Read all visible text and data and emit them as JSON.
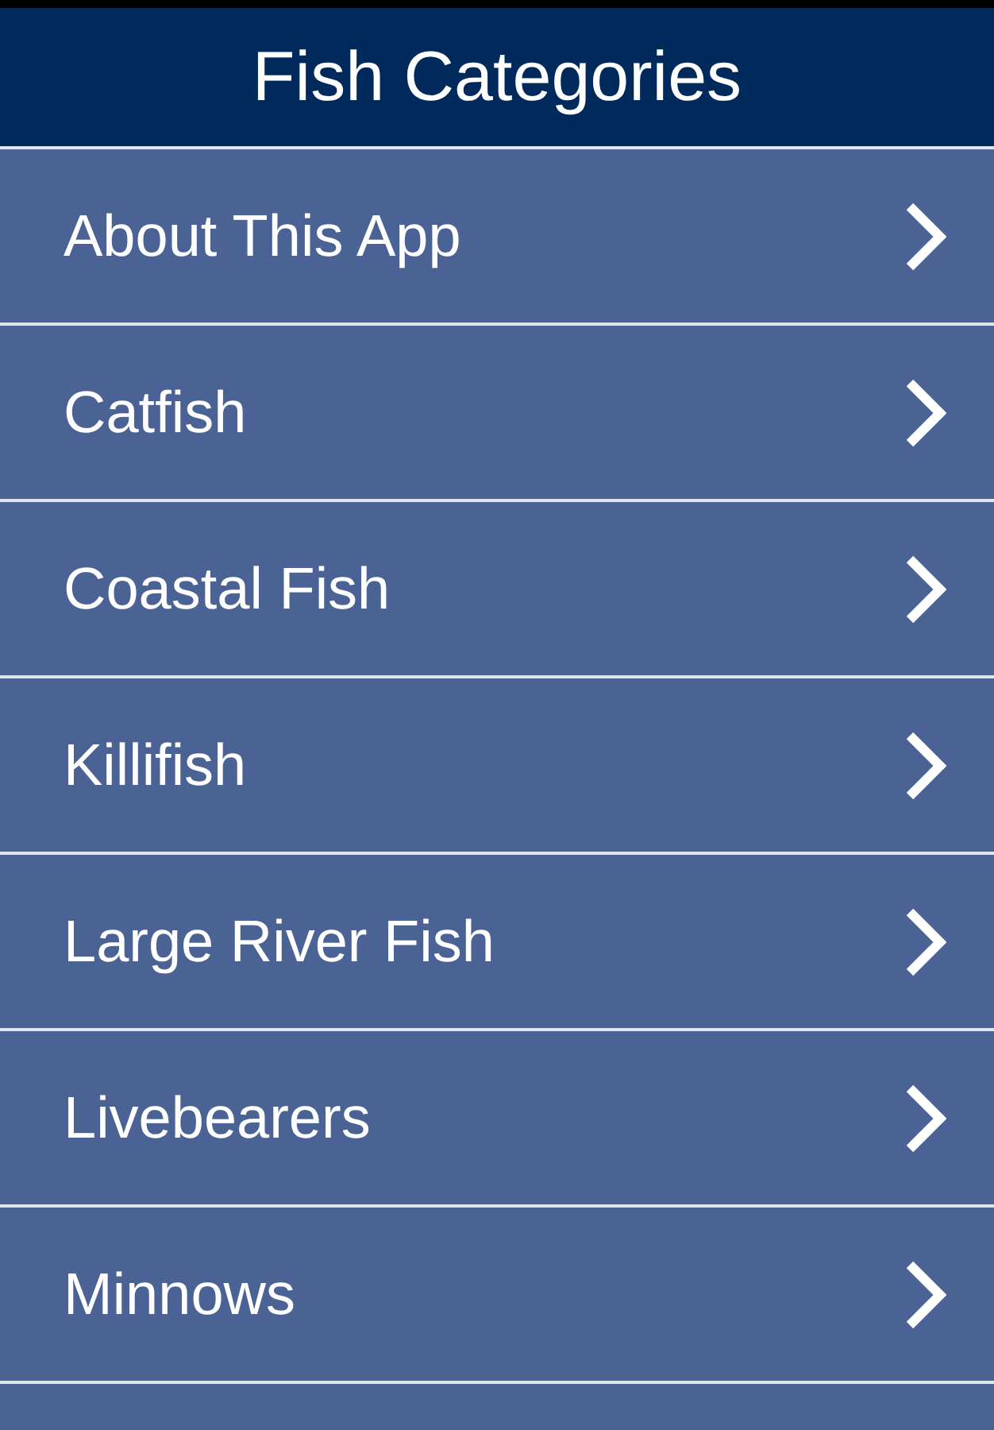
{
  "header": {
    "title": "Fish Categories"
  },
  "items": [
    {
      "label": "About This App"
    },
    {
      "label": "Catfish"
    },
    {
      "label": "Coastal Fish"
    },
    {
      "label": "Killifish"
    },
    {
      "label": "Large River Fish"
    },
    {
      "label": "Livebearers"
    },
    {
      "label": "Minnows"
    }
  ]
}
